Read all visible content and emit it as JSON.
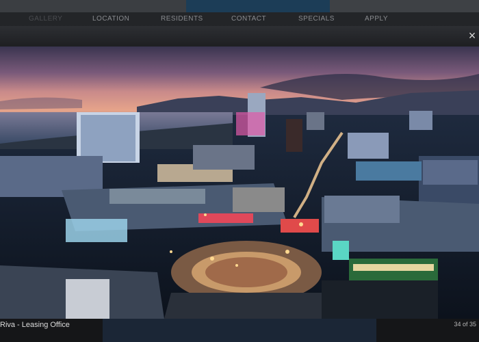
{
  "nav": {
    "items": [
      "GALLERY",
      "LOCATION",
      "RESIDENTS",
      "CONTACT",
      "SPECIALS",
      "APPLY"
    ]
  },
  "lightbox": {
    "close_icon": "close-icon",
    "caption": "Riva - Leasing Office",
    "counter": "34 of 35"
  },
  "colors": {
    "overlay": "#1a1a1c",
    "header_accent": "#1c3d57",
    "caption_text": "#dcdcdc"
  }
}
